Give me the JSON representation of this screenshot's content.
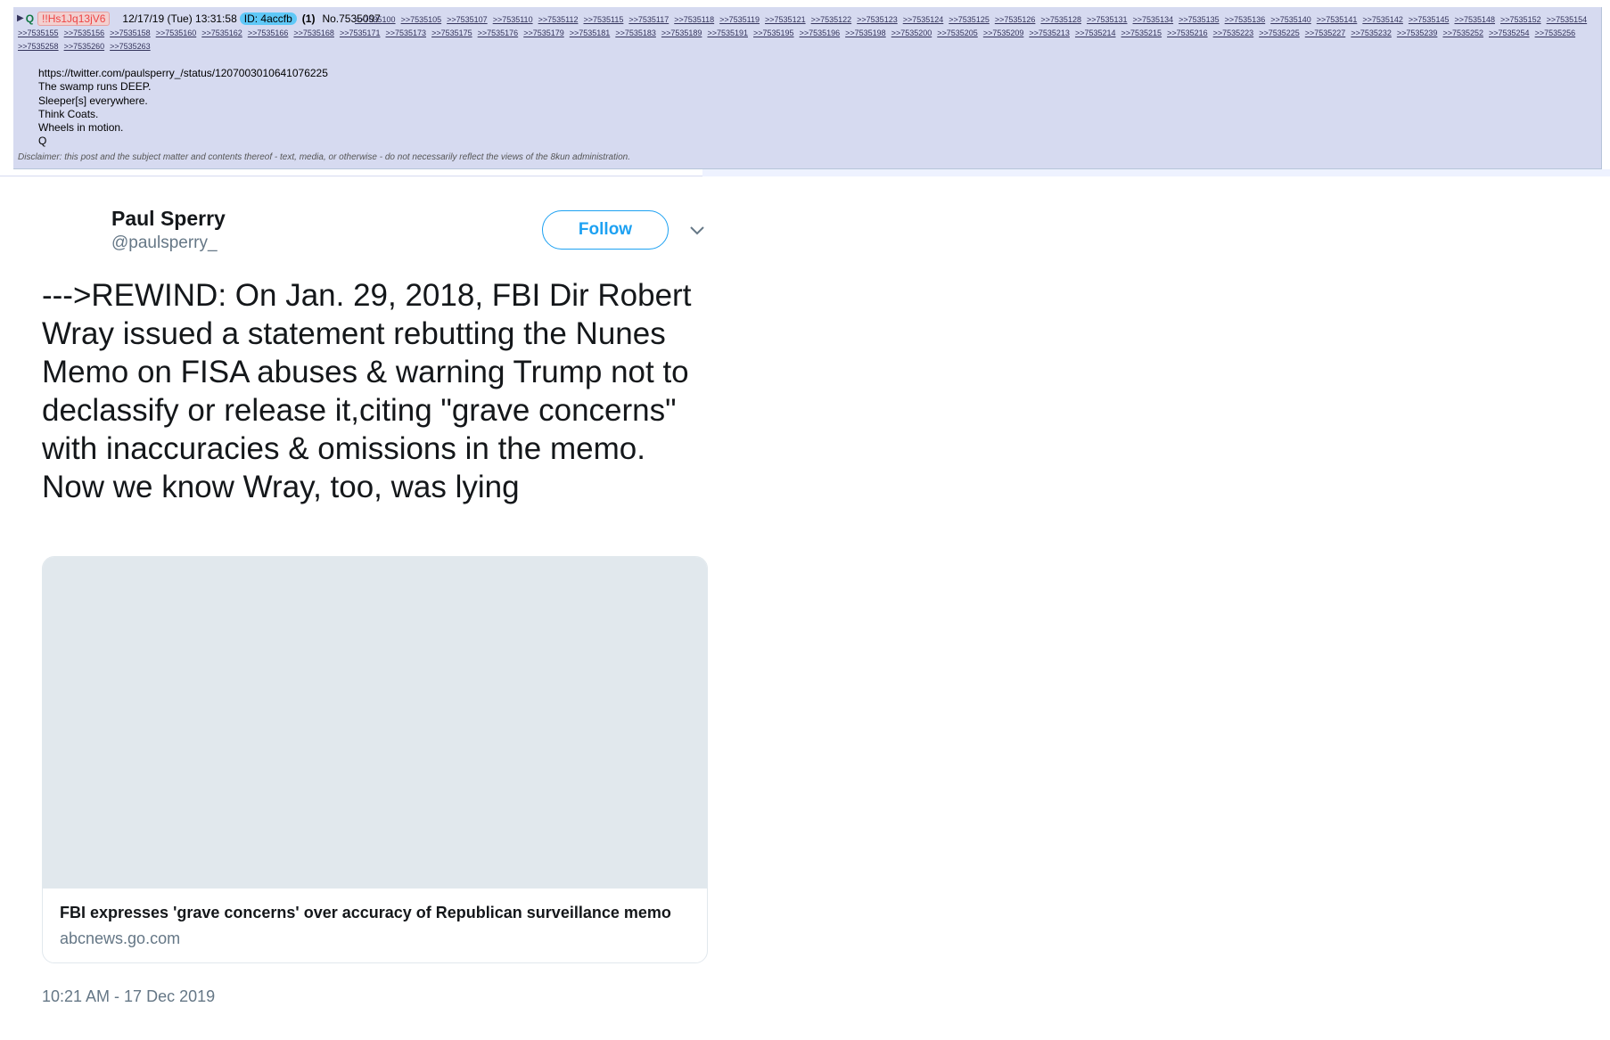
{
  "post": {
    "arrow": "▶",
    "name": "Q",
    "tripcode": "!!Hs1Jq13jV6",
    "date": "12/17/19 (Tue) 13:31:58",
    "id_label": "ID: 4accfb",
    "count": "(1)",
    "number": "No.7535097",
    "backlinks": [
      ">>7535100",
      ">>7535105",
      ">>7535107",
      ">>7535110",
      ">>7535112",
      ">>7535115",
      ">>7535117",
      ">>7535118",
      ">>7535119",
      ">>7535121",
      ">>7535122",
      ">>7535123",
      ">>7535124",
      ">>7535125",
      ">>7535126",
      ">>7535128",
      ">>7535131",
      ">>7535134",
      ">>7535135",
      ">>7535136",
      ">>7535140",
      ">>7535141",
      ">>7535142",
      ">>7535145",
      ">>7535148",
      ">>7535152",
      ">>7535154",
      ">>7535155",
      ">>7535156",
      ">>7535158",
      ">>7535160",
      ">>7535162",
      ">>7535166",
      ">>7535168",
      ">>7535171",
      ">>7535173",
      ">>7535175",
      ">>7535176",
      ">>7535179",
      ">>7535181",
      ">>7535183",
      ">>7535189",
      ">>7535191",
      ">>7535195",
      ">>7535196",
      ">>7535198",
      ">>7535200",
      ">>7535205",
      ">>7535209",
      ">>7535213",
      ">>7535214",
      ">>7535215",
      ">>7535216",
      ">>7535223",
      ">>7535225",
      ">>7535227",
      ">>7535232",
      ">>7535239",
      ">>7535252",
      ">>7535254",
      ">>7535256",
      ">>7535258",
      ">>7535260",
      ">>7535263"
    ],
    "body_lines": [
      "https://twitter.com/paulsperry_/status/1207003010641076225",
      "The swamp runs DEEP.",
      "Sleeper[s] everywhere.",
      "Think Coats.",
      "Wheels in motion.",
      "Q"
    ],
    "disclaimer": "Disclaimer: this post and the subject matter and contents thereof - text, media, or otherwise - do not necessarily reflect the views of the 8kun administration."
  },
  "tweet": {
    "author_name": "Paul Sperry",
    "author_handle": "@paulsperry_",
    "follow_label": "Follow",
    "text": "--->REWIND: On Jan. 29, 2018, FBI Dir Robert Wray issued a statement rebutting the Nunes Memo on FISA abuses & warning Trump not to declassify or release it,citing \"grave concerns\" with inaccuracies & omissions in the memo. Now we know Wray, too, was lying",
    "card_title": "FBI expresses 'grave concerns' over accuracy of Republican surveillance memo",
    "card_domain": "abcnews.go.com",
    "timestamp": "10:21 AM - 17 Dec 2019"
  },
  "colors": {
    "post_bg": "#d6daf0",
    "q_name": "#117743",
    "id_badge": "#5fc8f7",
    "twitter_blue": "#1da1f2",
    "muted": "#657786"
  },
  "icons": [
    "expand-arrow-icon",
    "chevron-down-icon"
  ]
}
